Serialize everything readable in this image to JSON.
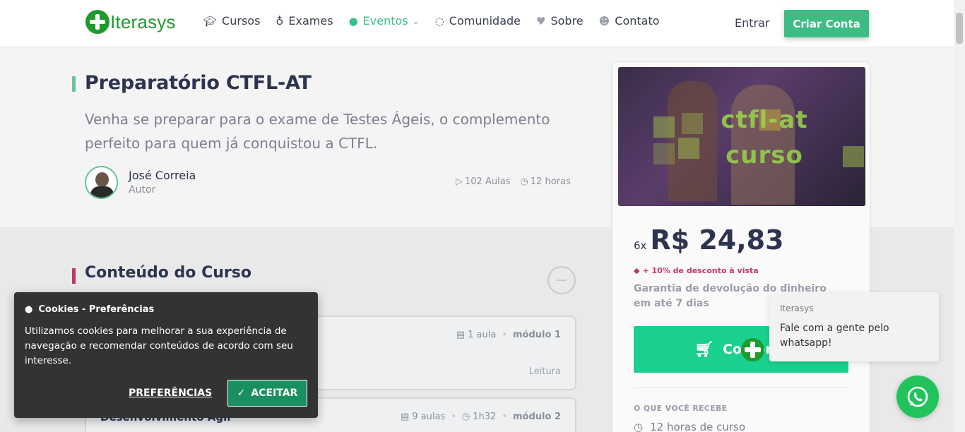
{
  "header": {
    "logo_text": "Iterasys",
    "nav": [
      {
        "label": "Cursos",
        "icon": "graduation-cap-icon"
      },
      {
        "label": "Exames",
        "icon": "medal-icon"
      },
      {
        "label": "Eventos",
        "icon": "chat-bubbles-icon",
        "active": true
      },
      {
        "label": "Comunidade",
        "icon": "loading-icon"
      },
      {
        "label": "Sobre",
        "icon": "heart-icon"
      },
      {
        "label": "Contato",
        "icon": "chat-icon"
      }
    ],
    "login": "Entrar",
    "signup": "Criar Conta"
  },
  "course": {
    "title": "Preparatório CTFL-AT",
    "subtitle": "Venha se preparar para o exame de Testes Ágeis, o complemento perfeito para quem já conquistou a CTFL.",
    "author_name": "José Correia",
    "author_role": "Autor",
    "lessons": "102 Aulas",
    "hours": "12 horas"
  },
  "content": {
    "section_title": "Conteúdo do Curso",
    "modules": [
      {
        "name": "",
        "lessons": "1 aula",
        "duration": "",
        "module": "módulo 1",
        "type": "Leitura"
      },
      {
        "name": "Desenvolvimento Ágil",
        "lessons": "9 aulas",
        "duration": "1h32",
        "module": "módulo 2",
        "type": ""
      }
    ]
  },
  "card": {
    "image_text": "ctfl-at curso",
    "installments": "6x",
    "price": "R$ 24,83",
    "discount": "+ 10% de desconto à vista",
    "guarantee": "Garantia de devolução do dinheiro em até 7 dias",
    "buy_label": "Comprar",
    "receive_title": "O QUE VOCÊ RECEBE",
    "receive_hours": "12 horas de curso"
  },
  "cookie": {
    "title": "Cookies - Preferências",
    "text": "Utilizamos cookies para melhorar a sua experiência de navegação e recomendar conteúdos de acordo com seu interesse.",
    "preferences": "PREFERÊNCIAS",
    "accept": "ACEITAR"
  },
  "whatsapp": {
    "from": "Iterasys",
    "message": "Fale com a gente pelo whatsapp!"
  },
  "colors": {
    "brand": "#1e9a2e",
    "accent": "#3dbc84",
    "buy": "#19d08e",
    "danger": "#c5365f"
  }
}
